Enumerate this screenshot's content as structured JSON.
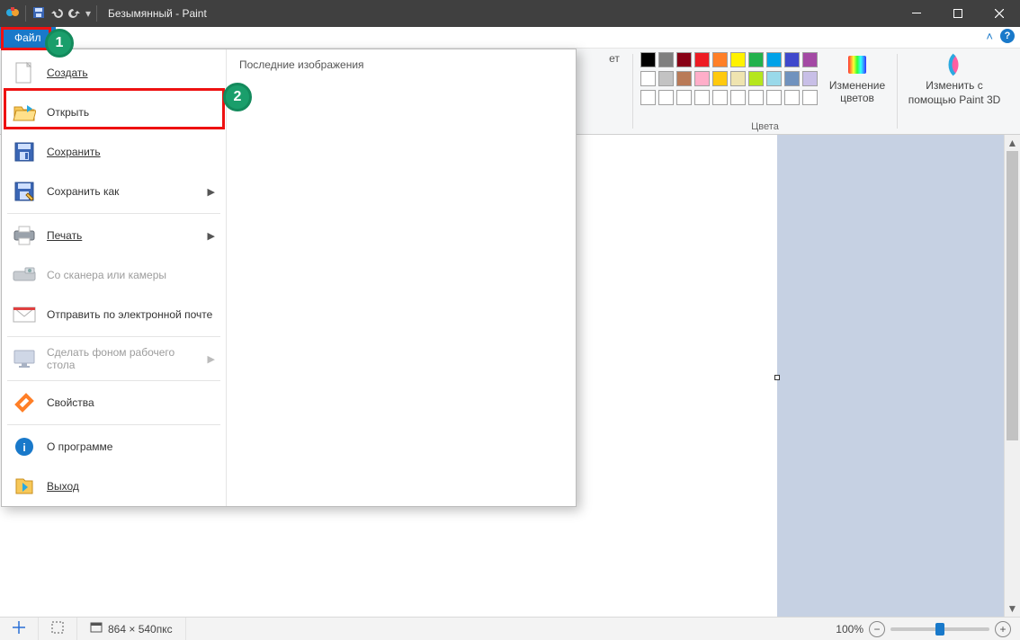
{
  "title": "Безымянный - Paint",
  "file_tab": "Файл",
  "ribbon": {
    "stub_label": "ет",
    "edit_colors": "Изменение цветов",
    "paint3d_line1": "Изменить с",
    "paint3d_line2": "помощью Paint 3D",
    "colors_group": "Цвета",
    "palette_row1": [
      "#000000",
      "#7f7f7f",
      "#880015",
      "#ed1c24",
      "#ff7f27",
      "#fff200",
      "#22b14c",
      "#00a2e8",
      "#3f48cc",
      "#a349a4"
    ],
    "palette_row2": [
      "#ffffff",
      "#c3c3c3",
      "#b97a57",
      "#ffaec9",
      "#ffc90e",
      "#efe4b0",
      "#b5e61d",
      "#99d9ea",
      "#7092be",
      "#c8bfe7"
    ],
    "palette_row3": [
      "#ffffff",
      "#ffffff",
      "#ffffff",
      "#ffffff",
      "#ffffff",
      "#ffffff",
      "#ffffff",
      "#ffffff",
      "#ffffff",
      "#ffffff"
    ]
  },
  "menu": {
    "recent_header": "Последние изображения",
    "items": {
      "new": "Создать",
      "open": "Открыть",
      "save": "Сохранить",
      "saveas": "Сохранить как",
      "print": "Печать",
      "scanner": "Со сканера или камеры",
      "email": "Отправить по электронной почте",
      "wallpaper": "Сделать фоном рабочего стола",
      "properties": "Свойства",
      "about": "О программе",
      "exit": "Выход"
    }
  },
  "status": {
    "size": "864 × 540пкс",
    "zoom": "100%"
  },
  "annotations": {
    "one": "1",
    "two": "2"
  }
}
